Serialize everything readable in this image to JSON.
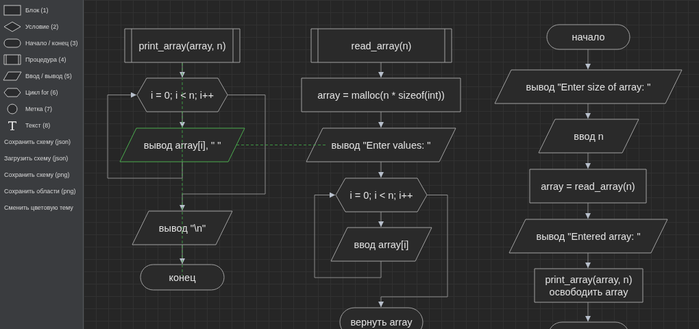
{
  "sidebar": {
    "shapes": [
      {
        "kind": "block",
        "label": "Блок (1)"
      },
      {
        "kind": "condition",
        "label": "Условие (2)"
      },
      {
        "kind": "terminal",
        "label": "Начало / конец (3)"
      },
      {
        "kind": "procedure",
        "label": "Процедура (4)"
      },
      {
        "kind": "io",
        "label": "Ввод / вывод (5)"
      },
      {
        "kind": "loop",
        "label": "Цикл for (6)"
      },
      {
        "kind": "label",
        "label": "Метка (7)"
      },
      {
        "kind": "text",
        "label": "Текст (8)"
      }
    ],
    "actions": [
      "Сохранить схему (json)",
      "Загрузить схему (json)",
      "Сохранить схему (png)",
      "Сохранить области (png)",
      "Сменить цветовую тему"
    ]
  },
  "flows": [
    {
      "nodes": [
        {
          "kind": "procedure",
          "lines": [
            "print_array(array, n)"
          ],
          "selected": false
        },
        {
          "kind": "loop",
          "lines": [
            "i = 0; i < n; i++"
          ],
          "selected": false
        },
        {
          "kind": "io",
          "lines": [
            "вывод array[i], \" \""
          ],
          "selected": true
        },
        {
          "kind": "io",
          "lines": [
            "вывод \"\\n\""
          ],
          "selected": false
        },
        {
          "kind": "terminal",
          "lines": [
            "конец"
          ],
          "selected": false
        }
      ]
    },
    {
      "nodes": [
        {
          "kind": "procedure",
          "lines": [
            "read_array(n)"
          ],
          "selected": false
        },
        {
          "kind": "process",
          "lines": [
            "array = malloc(n * sizeof(int))"
          ],
          "selected": false
        },
        {
          "kind": "io",
          "lines": [
            "вывод \"Enter values: \""
          ],
          "selected": false
        },
        {
          "kind": "loop",
          "lines": [
            "i = 0; i < n; i++"
          ],
          "selected": false
        },
        {
          "kind": "io",
          "lines": [
            "ввод array[i]"
          ],
          "selected": false
        },
        {
          "kind": "terminal",
          "lines": [
            "вернуть array"
          ],
          "selected": false
        }
      ]
    },
    {
      "nodes": [
        {
          "kind": "terminal",
          "lines": [
            "начало"
          ],
          "selected": false
        },
        {
          "kind": "io",
          "lines": [
            "вывод \"Enter size of array: \""
          ],
          "selected": false
        },
        {
          "kind": "io",
          "lines": [
            "ввод n"
          ],
          "selected": false
        },
        {
          "kind": "process",
          "lines": [
            "array = read_array(n)"
          ],
          "selected": false
        },
        {
          "kind": "io",
          "lines": [
            "вывод \"Entered array: \""
          ],
          "selected": false
        },
        {
          "kind": "process",
          "lines": [
            "print_array(array, n)",
            "освободить array"
          ],
          "selected": false
        },
        {
          "kind": "terminal",
          "selected": false
        }
      ]
    }
  ]
}
